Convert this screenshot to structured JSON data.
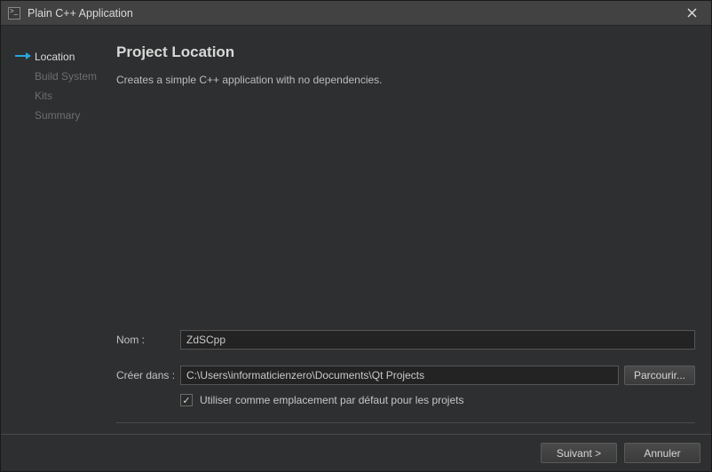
{
  "window": {
    "title": "Plain C++ Application"
  },
  "sidebar": {
    "items": [
      {
        "label": "Location",
        "active": true
      },
      {
        "label": "Build System",
        "active": false
      },
      {
        "label": "Kits",
        "active": false
      },
      {
        "label": "Summary",
        "active": false
      }
    ]
  },
  "main": {
    "heading": "Project Location",
    "description": "Creates a simple C++ application with no dependencies.",
    "name_label": "Nom :",
    "name_value": "ZdSCpp",
    "path_label": "Créer dans :",
    "path_value": "C:\\Users\\informaticienzero\\Documents\\Qt Projects",
    "browse_label": "Parcourir...",
    "default_checkbox_label": "Utiliser comme emplacement par défaut pour les projets",
    "default_checked": true
  },
  "footer": {
    "next_label": "Suivant >",
    "cancel_label": "Annuler"
  }
}
